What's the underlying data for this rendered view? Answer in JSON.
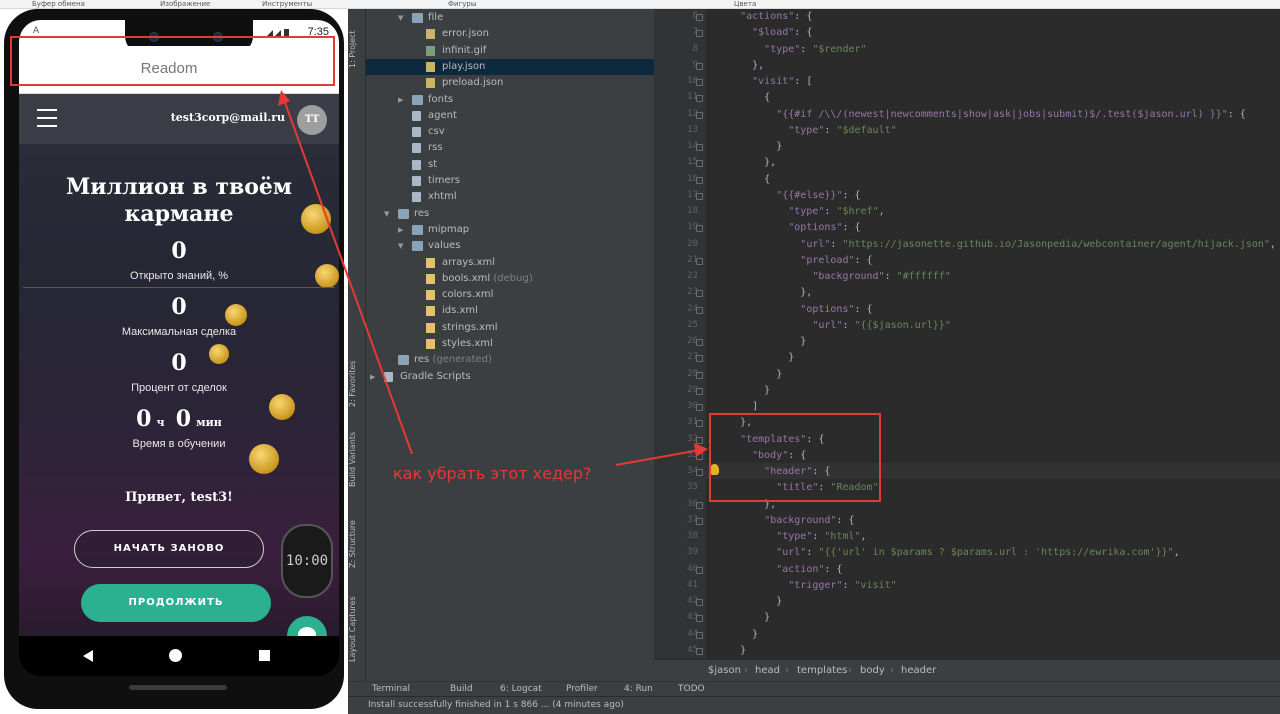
{
  "ribbon": [
    "Буфер обмена",
    "Изображение",
    "Инструменты",
    "Фигуры",
    "Цвета"
  ],
  "phone": {
    "status_time": "7:35",
    "status_left": "A",
    "header_title": "Readom",
    "email": "test3corp@mail.ru",
    "avatar": "TT",
    "hero_title_1": "Миллион в твоём",
    "hero_title_2": "кармане",
    "stats": [
      {
        "value": "0",
        "label": "Открыто знаний, %"
      },
      {
        "value": "0",
        "label": "Максимальная сделка"
      },
      {
        "value": "0",
        "label": "Процент от сделок"
      }
    ],
    "time_hours": "0",
    "time_h_unit": "ч",
    "time_minutes": "0",
    "time_m_unit": "мин",
    "time_label": "Время в обучении",
    "greeting": "Привет, test3!",
    "btn_restart": "НАЧАТЬ ЗАНОВО",
    "btn_continue": "ПРОДОЛЖИТЬ",
    "watch_text": "10:00"
  },
  "ide": {
    "left_tabs": [
      "1: Project",
      "2: Favorites",
      "Build Variants",
      "Z: Structure",
      "Layout Captures"
    ],
    "tree": [
      {
        "indent": 2,
        "type": "folder",
        "label": "file",
        "expanded": true
      },
      {
        "indent": 3,
        "type": "json",
        "label": "error.json"
      },
      {
        "indent": 3,
        "type": "gif",
        "label": "infinit.gif"
      },
      {
        "indent": 3,
        "type": "json",
        "label": "play.json",
        "selected": true
      },
      {
        "indent": 3,
        "type": "json",
        "label": "preload.json"
      },
      {
        "indent": 2,
        "type": "folder",
        "label": "fonts",
        "expanded": false
      },
      {
        "indent": 2,
        "type": "file",
        "label": "agent"
      },
      {
        "indent": 2,
        "type": "file",
        "label": "csv"
      },
      {
        "indent": 2,
        "type": "file",
        "label": "rss"
      },
      {
        "indent": 2,
        "type": "file",
        "label": "st"
      },
      {
        "indent": 2,
        "type": "file",
        "label": "timers"
      },
      {
        "indent": 2,
        "type": "file",
        "label": "xhtml"
      },
      {
        "indent": 1,
        "type": "folder",
        "label": "res",
        "expanded": true
      },
      {
        "indent": 2,
        "type": "folder",
        "label": "mipmap",
        "expanded": false
      },
      {
        "indent": 2,
        "type": "folder",
        "label": "values",
        "expanded": true
      },
      {
        "indent": 3,
        "type": "xml",
        "label": "arrays.xml"
      },
      {
        "indent": 3,
        "type": "xml",
        "label": "bools.xml",
        "suffix": "(debug)"
      },
      {
        "indent": 3,
        "type": "xml",
        "label": "colors.xml"
      },
      {
        "indent": 3,
        "type": "xml",
        "label": "ids.xml"
      },
      {
        "indent": 3,
        "type": "xml",
        "label": "strings.xml"
      },
      {
        "indent": 3,
        "type": "xml",
        "label": "styles.xml"
      },
      {
        "indent": 1,
        "type": "folder",
        "label": "res",
        "suffix": "(generated)"
      },
      {
        "indent": 0,
        "type": "file",
        "label": "Gradle Scripts",
        "expanded": false
      }
    ],
    "code_lines": [
      {
        "n": "6",
        "t": "    \"actions\": {"
      },
      {
        "n": "7",
        "t": "      \"$load\": {"
      },
      {
        "n": "8",
        "t": "        \"type\": \"$render\""
      },
      {
        "n": "9",
        "t": "      },"
      },
      {
        "n": "10",
        "t": "      \"visit\": ["
      },
      {
        "n": "11",
        "t": "        {"
      },
      {
        "n": "12",
        "t": "          \"{{#if /\\\\/(newest|newcomments|show|ask|jobs|submit)$/.test($jason.url) }}\": {"
      },
      {
        "n": "13",
        "t": "            \"type\": \"$default\""
      },
      {
        "n": "14",
        "t": "          }"
      },
      {
        "n": "15",
        "t": "        },"
      },
      {
        "n": "16",
        "t": "        {"
      },
      {
        "n": "17",
        "t": "          \"{{#else}}\": {"
      },
      {
        "n": "18",
        "t": "            \"type\": \"$href\","
      },
      {
        "n": "19",
        "t": "            \"options\": {"
      },
      {
        "n": "20",
        "t": "              \"url\": \"https://jasonette.github.io/Jasonpedia/webcontainer/agent/hijack.json\","
      },
      {
        "n": "21",
        "t": "              \"preload\": {"
      },
      {
        "n": "22",
        "t": "                \"background\": \"#ffffff\""
      },
      {
        "n": "23",
        "t": "              },"
      },
      {
        "n": "24",
        "t": "              \"options\": {"
      },
      {
        "n": "25",
        "t": "                \"url\": \"{{$jason.url}}\""
      },
      {
        "n": "26",
        "t": "              }"
      },
      {
        "n": "27",
        "t": "            }"
      },
      {
        "n": "28",
        "t": "          }"
      },
      {
        "n": "29",
        "t": "        }"
      },
      {
        "n": "30",
        "t": "      ]"
      },
      {
        "n": "31",
        "t": "    },"
      },
      {
        "n": "32",
        "t": "    \"templates\": {"
      },
      {
        "n": "33",
        "t": "      \"body\": {"
      },
      {
        "n": "34",
        "t": "        \"header\": {"
      },
      {
        "n": "35",
        "t": "          \"title\": \"Readom\""
      },
      {
        "n": "36",
        "t": "        },"
      },
      {
        "n": "37",
        "t": "        \"background\": {"
      },
      {
        "n": "38",
        "t": "          \"type\": \"html\","
      },
      {
        "n": "39",
        "t": "          \"url\": \"{{'url' in $params ? $params.url : 'https://ewrika.com'}}\","
      },
      {
        "n": "40",
        "t": "          \"action\": {"
      },
      {
        "n": "41",
        "t": "            \"trigger\": \"visit\""
      },
      {
        "n": "42",
        "t": "          }"
      },
      {
        "n": "43",
        "t": "        }"
      },
      {
        "n": "44",
        "t": "      }"
      },
      {
        "n": "45",
        "t": "    }"
      }
    ],
    "breadcrumb": [
      "$jason",
      "head",
      "templates",
      "body",
      "header"
    ],
    "bottom_tools": [
      "Terminal",
      "Build",
      "6: Logcat",
      "Profiler",
      "4: Run",
      "TODO"
    ],
    "status_message": "Install successfully finished in 1 s 866 ... (4 minutes ago)"
  },
  "annotation": "как убрать этот хедер?",
  "colors": {
    "annotation_red": "#e53935",
    "accent_green": "#2bb18f"
  }
}
